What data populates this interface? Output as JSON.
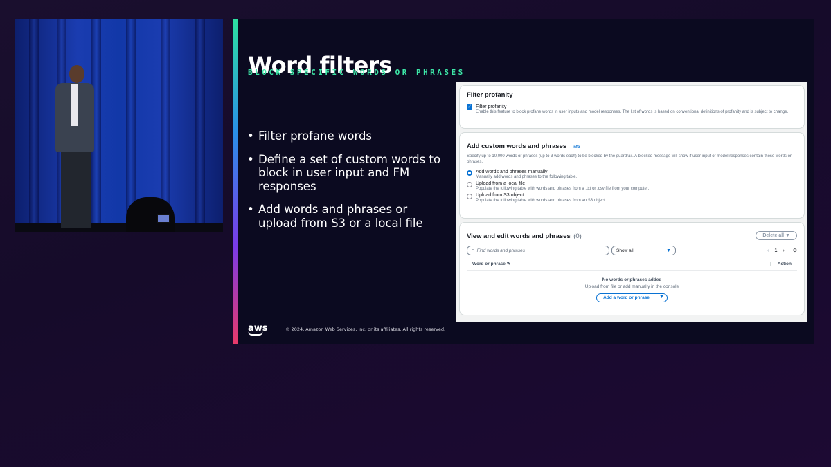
{
  "slide": {
    "title": "Word filters",
    "subtitle": "BLOCK SPECIFIC WORDS OR PHRASES",
    "bullets": [
      "Filter profane words",
      "Define a set of custom words to block in user input and FM responses",
      "Add words and phrases or upload from S3 or a local file"
    ],
    "logo_text": "aws",
    "copyright": "© 2024, Amazon Web Services, Inc. or its affiliates. All rights reserved."
  },
  "console": {
    "profanity": {
      "heading": "Filter profanity",
      "checkbox_label": "Filter profanity",
      "checkbox_checked": true,
      "checkbox_desc": "Enable this feature to block profane words in user inputs and model responses. The list of words is based on conventional definitions of profanity and is subject to change."
    },
    "custom": {
      "heading": "Add custom words and phrases",
      "info_link": "Info",
      "desc": "Specify up to 10,000 words or phrases (up to 3 words each) to be blocked by the guardrail. A blocked message will show if user input or model responses contain these words or phrases.",
      "options": [
        {
          "label": "Add words and phrases manually",
          "desc": "Manually add words and phrases to the following table.",
          "selected": true
        },
        {
          "label": "Upload from a local file",
          "desc": "Populate the following table with words and phrases from a .txt or .csv file from your computer.",
          "selected": false
        },
        {
          "label": "Upload from S3 object",
          "desc": "Populate the following table with words and phrases from an S3 object.",
          "selected": false
        }
      ]
    },
    "table": {
      "heading": "View and edit words and phrases",
      "count": "(0)",
      "delete_all": "Delete all",
      "search_placeholder": "Find words and phrases",
      "filter_value": "Show all",
      "page": "1",
      "col_word": "Word or phrase",
      "col_action": "Action",
      "empty_title": "No words or phrases added",
      "empty_sub": "Upload from file or add manually in the console",
      "add_button": "Add a word or phrase"
    }
  },
  "colors": {
    "accent_green": "#3de8a8",
    "aws_blue": "#0972d3",
    "slide_bg": "#0b0a20"
  }
}
